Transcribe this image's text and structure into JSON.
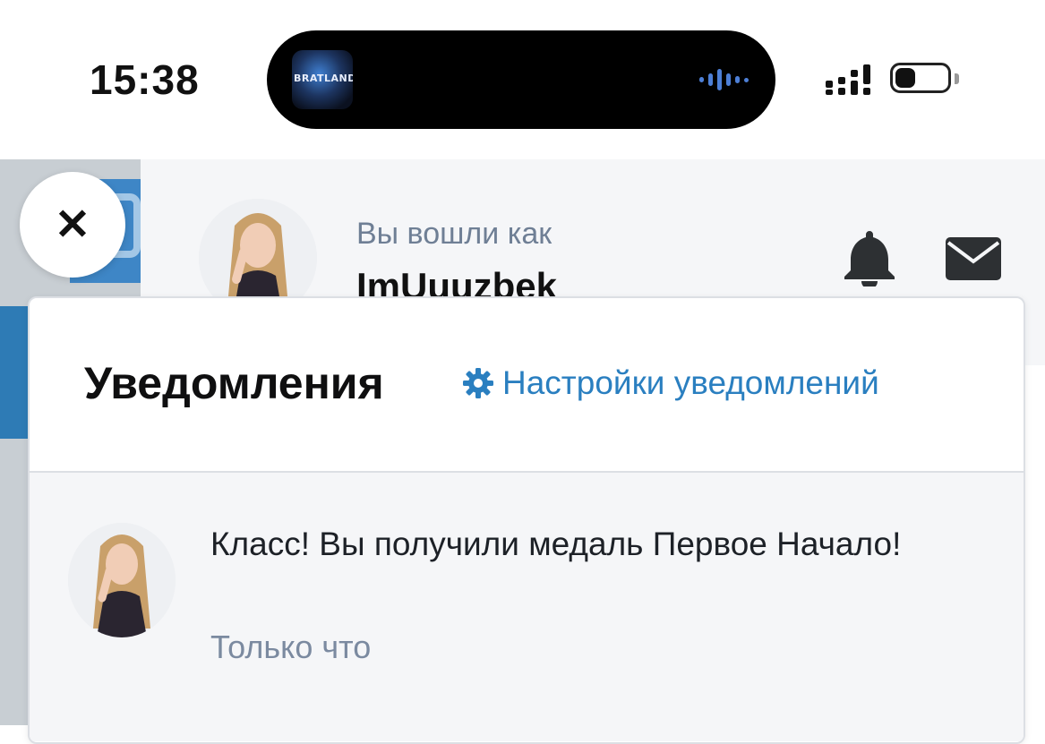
{
  "status_bar": {
    "time": "15:38",
    "island_app_label": "BRATLAND"
  },
  "header": {
    "logged_in_label": "Вы вошли как",
    "username": "ImUuuzbek"
  },
  "notifications": {
    "title": "Уведомления",
    "settings_link": "Настройки уведомлений",
    "items": [
      {
        "text": "Класс! Вы получили медаль Первое Начало!",
        "time": "Только что"
      }
    ]
  },
  "icons": {
    "close": "close-icon",
    "bell": "bell-icon",
    "mail": "mail-icon",
    "gear": "gear-icon"
  },
  "colors": {
    "accent": "#2a7fc0",
    "muted": "#7b8aa0",
    "panel_bg": "#f5f6f8"
  }
}
